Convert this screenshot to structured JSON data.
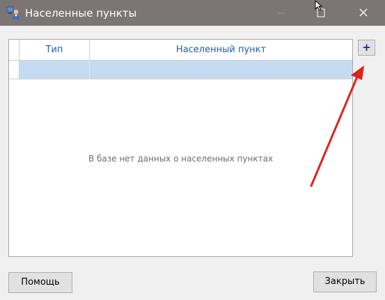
{
  "window": {
    "title": "Населенные пункты",
    "icons": {
      "app": "users-icon",
      "minimize": "minimize-icon",
      "maximize": "maximize-icon",
      "close": "close-icon"
    }
  },
  "grid": {
    "columns": [
      "Тип",
      "Населенный пункт"
    ],
    "rows": [],
    "empty_message": "В базе нет данных о населенных пунктах"
  },
  "toolbar": {
    "add_label": "+"
  },
  "buttons": {
    "help": "Помощь",
    "close": "Закрыть"
  },
  "annotation": {
    "arrow_color": "#e0201b"
  }
}
